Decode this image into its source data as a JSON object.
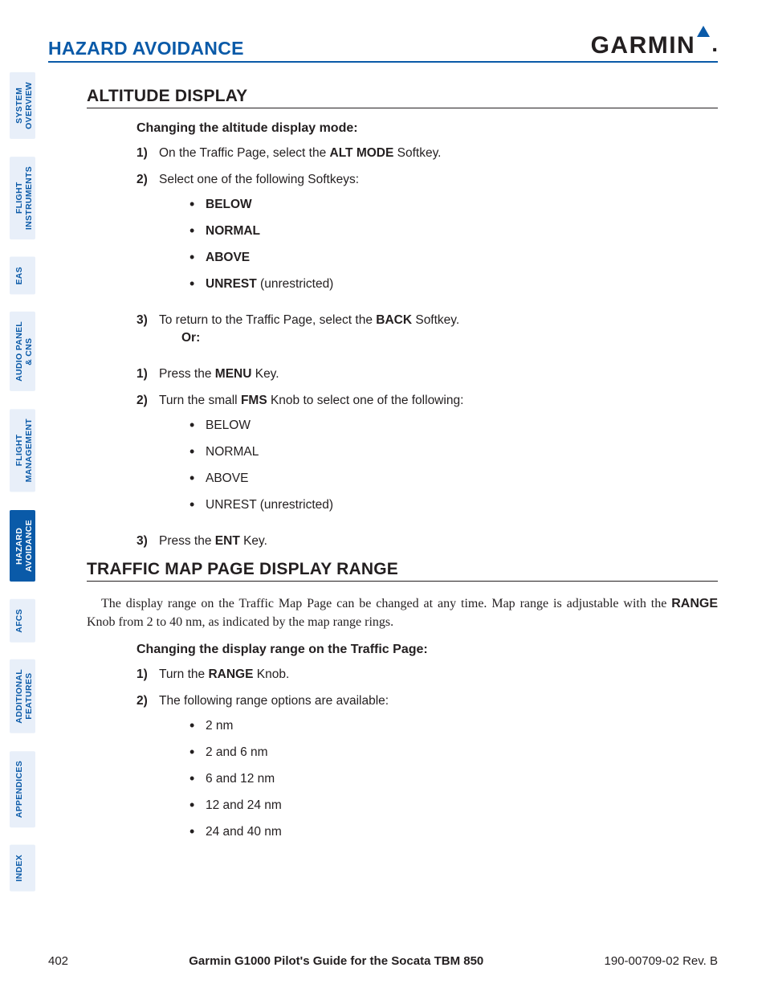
{
  "header": {
    "section": "HAZARD AVOIDANCE",
    "brand": "GARMIN"
  },
  "sidebar": {
    "tabs": [
      {
        "label": "SYSTEM\nOVERVIEW",
        "active": false
      },
      {
        "label": "FLIGHT\nINSTRUMENTS",
        "active": false
      },
      {
        "label": "EAS",
        "active": false
      },
      {
        "label": "AUDIO PANEL\n& CNS",
        "active": false
      },
      {
        "label": "FLIGHT\nMANAGEMENT",
        "active": false
      },
      {
        "label": "HAZARD\nAVOIDANCE",
        "active": true
      },
      {
        "label": "AFCS",
        "active": false
      },
      {
        "label": "ADDITIONAL\nFEATURES",
        "active": false
      },
      {
        "label": "APPENDICES",
        "active": false
      },
      {
        "label": "INDEX",
        "active": false
      }
    ]
  },
  "sections": {
    "s1": {
      "title": "ALTITUDE DISPLAY",
      "sub": "Changing the altitude display mode:",
      "steps": {
        "a1_pre": "On the Traffic Page, select the ",
        "a1_b": "ALT MODE",
        "a1_post": " Softkey.",
        "a2": "Select one of the following Softkeys:",
        "opts1": {
          "o1": "BELOW",
          "o2": "NORMAL",
          "o3": "ABOVE",
          "o4b": "UNREST",
          "o4p": " (unrestricted)"
        },
        "a3_pre": "To return to the Traffic Page, select the ",
        "a3_b": "BACK",
        "a3_post": " Softkey.",
        "or": "Or",
        "b1_pre": "Press the ",
        "b1_b": "MENU",
        "b1_post": " Key.",
        "b2_pre": "Turn the small ",
        "b2_b": "FMS",
        "b2_post": " Knob to select one of the following:",
        "opts2": {
          "o1": "BELOW",
          "o2": "NORMAL",
          "o3": "ABOVE",
          "o4": "UNREST (unrestricted)"
        },
        "b3_pre": "Press the ",
        "b3_b": "ENT",
        "b3_post": " Key."
      }
    },
    "s2": {
      "title": "TRAFFIC MAP PAGE DISPLAY RANGE",
      "para_pre": "The display range on the Traffic Map Page can be changed at any time.  Map range is adjustable with the ",
      "para_b": "RANGE",
      "para_post": " Knob from 2 to 40 nm, as indicated by the map range rings.",
      "sub": "Changing the display range on the Traffic Page:",
      "c1_pre": "Turn the ",
      "c1_b": "RANGE",
      "c1_post": " Knob.",
      "c2": "The following range options are available:",
      "opts": {
        "o1": "2 nm",
        "o2": "2 and 6 nm",
        "o3": "6 and 12 nm",
        "o4": "12 and 24 nm",
        "o5": "24 and 40 nm"
      }
    }
  },
  "footer": {
    "page": "402",
    "title": "Garmin G1000 Pilot's Guide for the Socata TBM 850",
    "docrev": "190-00709-02  Rev. B"
  },
  "nums": {
    "n1": "1)",
    "n2": "2)",
    "n3": "3)"
  }
}
